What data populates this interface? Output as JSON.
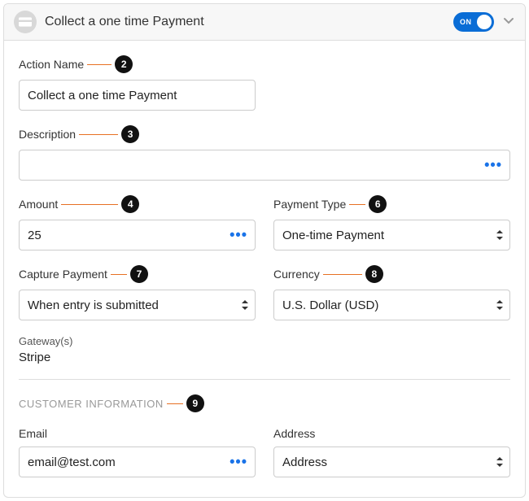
{
  "header": {
    "title": "Collect a one time Payment",
    "toggle_label": "ON"
  },
  "fields": {
    "action_name": {
      "label": "Action Name",
      "value": "Collect a one time Payment"
    },
    "description": {
      "label": "Description",
      "value": ""
    },
    "amount": {
      "label": "Amount",
      "value": "25"
    },
    "payment_type": {
      "label": "Payment Type",
      "value": "One-time Payment"
    },
    "capture_payment": {
      "label": "Capture Payment",
      "value": "When entry is submitted"
    },
    "currency": {
      "label": "Currency",
      "value": "U.S. Dollar (USD)"
    },
    "gateway": {
      "label": "Gateway(s)",
      "value": "Stripe"
    },
    "email": {
      "label": "Email",
      "value": "email@test.com"
    },
    "address": {
      "label": "Address",
      "value": "Address"
    }
  },
  "section": {
    "customer_info": "CUSTOMER INFORMATION"
  },
  "callouts": {
    "c2": "2",
    "c3": "3",
    "c4": "4",
    "c6": "6",
    "c7": "7",
    "c8": "8",
    "c9": "9"
  }
}
